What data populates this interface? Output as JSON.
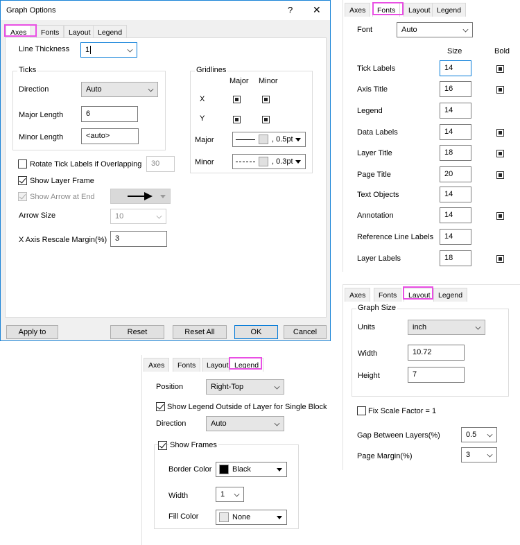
{
  "dialog": {
    "title": "Graph Options",
    "help_glyph": "?",
    "close_glyph": "✕",
    "tabs": [
      "Axes",
      "Fonts",
      "Layout",
      "Legend"
    ],
    "active_tab": "Axes",
    "buttons": {
      "apply": "Apply to",
      "reset": "Reset",
      "reset_all": "Reset All",
      "ok": "OK",
      "cancel": "Cancel"
    }
  },
  "axes": {
    "line_thickness": {
      "label": "Line Thickness",
      "value": "1"
    },
    "ticks": {
      "title": "Ticks",
      "direction": {
        "label": "Direction",
        "value": "Auto"
      },
      "major_length": {
        "label": "Major Length",
        "value": "6"
      },
      "minor_length": {
        "label": "Minor Length",
        "value": "<auto>"
      }
    },
    "gridlines": {
      "title": "Gridlines",
      "col_major": "Major",
      "col_minor": "Minor",
      "row_x": "X",
      "row_y": "Y",
      "major": {
        "label": "Major",
        "value": ", 0.5pt"
      },
      "minor": {
        "label": "Minor",
        "value": ", 0.3pt"
      }
    },
    "rotate_tick_labels": {
      "label": "Rotate Tick Labels if Overlapping",
      "checked": false,
      "value": "30"
    },
    "show_layer_frame": {
      "label": "Show Layer Frame",
      "checked": true
    },
    "show_arrow_at_end": {
      "label": "Show Arrow at End",
      "checked": true,
      "disabled": true
    },
    "arrow_size": {
      "label": "Arrow Size",
      "value": "10"
    },
    "x_axis_rescale_margin": {
      "label": "X Axis Rescale Margin(%)",
      "value": "3"
    }
  },
  "fonts_panel": {
    "tabs": [
      "Axes",
      "Fonts",
      "Layout",
      "Legend"
    ],
    "font": {
      "label": "Font",
      "value": "Auto"
    },
    "col_size": "Size",
    "col_bold": "Bold",
    "rows": [
      {
        "label": "Tick Labels",
        "size": "14",
        "bold": true
      },
      {
        "label": "Axis Title",
        "size": "16",
        "bold": true
      },
      {
        "label": "Legend",
        "size": "14",
        "bold": false
      },
      {
        "label": "Data Labels",
        "size": "14",
        "bold": true
      },
      {
        "label": "Layer Title",
        "size": "18",
        "bold": true
      },
      {
        "label": "Page Title",
        "size": "20",
        "bold": true
      },
      {
        "label": "Text Objects",
        "size": "14",
        "bold": false
      },
      {
        "label": "Annotation",
        "size": "14",
        "bold": true
      },
      {
        "label": "Reference Line Labels",
        "size": "14",
        "bold": false
      },
      {
        "label": "Layer Labels",
        "size": "18",
        "bold": true
      }
    ]
  },
  "layout_panel": {
    "tabs": [
      "Axes",
      "Fonts",
      "Layout",
      "Legend"
    ],
    "graph_size": "Graph Size",
    "units": {
      "label": "Units",
      "value": "inch"
    },
    "width": {
      "label": "Width",
      "value": "10.72"
    },
    "height": {
      "label": "Height",
      "value": "7"
    },
    "fix_scale": {
      "label": "Fix Scale Factor = 1",
      "checked": false
    },
    "gap_between_layers": {
      "label": "Gap Between Layers(%)",
      "value": "0.5"
    },
    "page_margin": {
      "label": "Page Margin(%)",
      "value": "3"
    }
  },
  "legend_panel": {
    "tabs": [
      "Axes",
      "Fonts",
      "Layout",
      "Legend"
    ],
    "position": {
      "label": "Position",
      "value": "Right-Top"
    },
    "show_outside": {
      "label": "Show Legend Outside of Layer for Single Block",
      "checked": true
    },
    "direction": {
      "label": "Direction",
      "value": "Auto"
    },
    "show_frames": {
      "label": "Show Frames",
      "checked": true
    },
    "border_color": {
      "label": "Border Color",
      "value": "Black",
      "swatch": "#000000"
    },
    "width": {
      "label": "Width",
      "value": "1"
    },
    "fill_color": {
      "label": "Fill Color",
      "value": "None",
      "swatch": "#e8e8e8"
    }
  },
  "colors": {
    "highlight": "#e94fe4",
    "accent": "#0078d7",
    "dialog_border": "#1883d7"
  }
}
